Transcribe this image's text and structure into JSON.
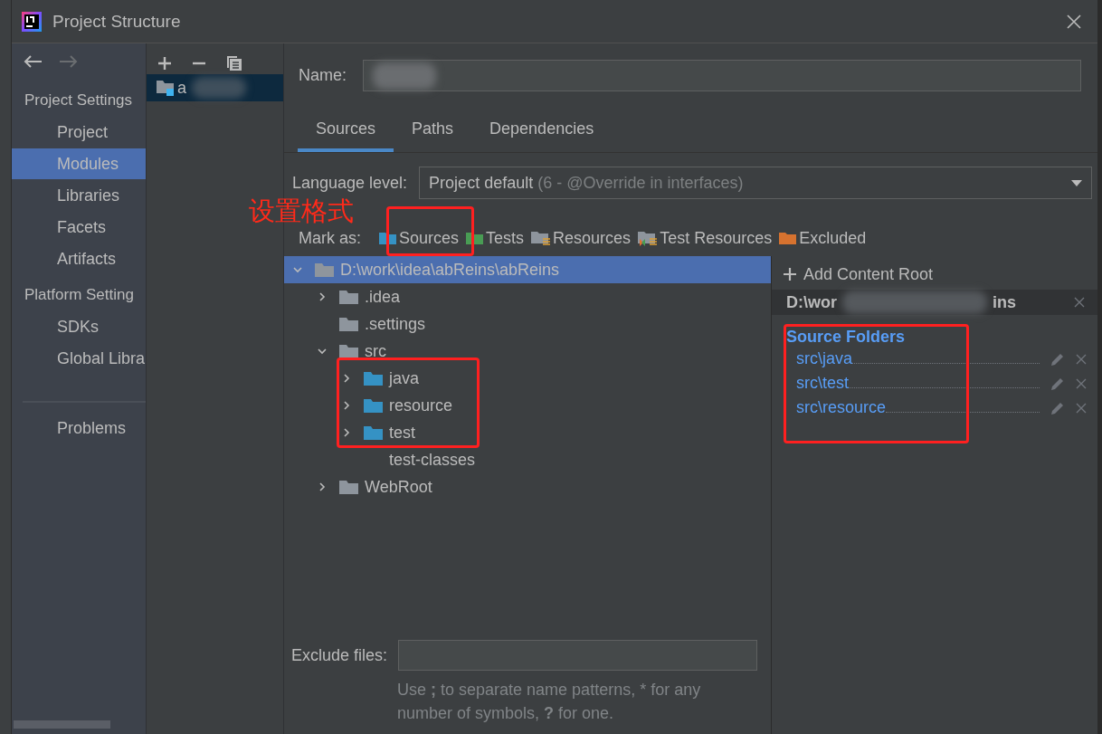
{
  "window": {
    "title": "Project Structure"
  },
  "sidebar": {
    "sections": [
      {
        "label": "Project Settings",
        "items": [
          {
            "label": "Project",
            "selected": false
          },
          {
            "label": "Modules",
            "selected": true
          },
          {
            "label": "Libraries",
            "selected": false
          },
          {
            "label": "Facets",
            "selected": false
          },
          {
            "label": "Artifacts",
            "selected": false
          }
        ]
      },
      {
        "label": "Platform Setting",
        "items": [
          {
            "label": "SDKs",
            "selected": false
          },
          {
            "label": "Global Libra",
            "selected": false
          }
        ]
      },
      {
        "items": [
          {
            "label": "Problems",
            "selected": false
          }
        ]
      }
    ]
  },
  "modules": [
    {
      "label": "a",
      "selected": true
    }
  ],
  "name_field": {
    "label": "Name:"
  },
  "tabs": [
    {
      "label": "Sources",
      "selected": true
    },
    {
      "label": "Paths",
      "selected": false
    },
    {
      "label": "Dependencies",
      "selected": false
    }
  ],
  "language_level": {
    "label": "Language level:",
    "value": "Project default",
    "detail": "(6 - @Override in interfaces)"
  },
  "annotation": {
    "text": "设置格式"
  },
  "mark_as": {
    "label": "Mark as:",
    "items": [
      {
        "label": "Sources",
        "kind": "sources"
      },
      {
        "label": "Tests",
        "kind": "tests"
      },
      {
        "label": "Resources",
        "kind": "resources"
      },
      {
        "label": "Test Resources",
        "kind": "test-resources"
      },
      {
        "label": "Excluded",
        "kind": "excluded"
      }
    ]
  },
  "tree": [
    {
      "label": "D:\\work\\idea\\abReins\\abReins",
      "kind": "plain",
      "selected": true,
      "expanded": true,
      "children": [
        {
          "label": ".idea",
          "kind": "plain",
          "selected": false,
          "expanded": false
        },
        {
          "label": ".settings",
          "kind": "plain",
          "selected": false
        },
        {
          "label": "src",
          "kind": "plain",
          "selected": false,
          "expanded": true,
          "children": [
            {
              "label": "java",
              "kind": "source",
              "selected": false,
              "expanded": false
            },
            {
              "label": "resource",
              "kind": "source",
              "selected": false,
              "expanded": false
            },
            {
              "label": "test",
              "kind": "source",
              "selected": false,
              "expanded": false
            },
            {
              "label": "test-classes",
              "kind": "none",
              "selected": false
            }
          ]
        },
        {
          "label": "WebRoot",
          "kind": "plain",
          "selected": false,
          "expanded": false
        }
      ]
    }
  ],
  "content_root": {
    "add_label": "Add Content Root",
    "path_start": "D:\\wor",
    "path_end": "ins",
    "group_title": "Source Folders",
    "folders": [
      "src\\java",
      "src\\test",
      "src\\resource"
    ]
  },
  "exclude": {
    "label": "Exclude files:",
    "hint": "Use **;** to separate name patterns, * for any number of symbols, **?** for one."
  }
}
